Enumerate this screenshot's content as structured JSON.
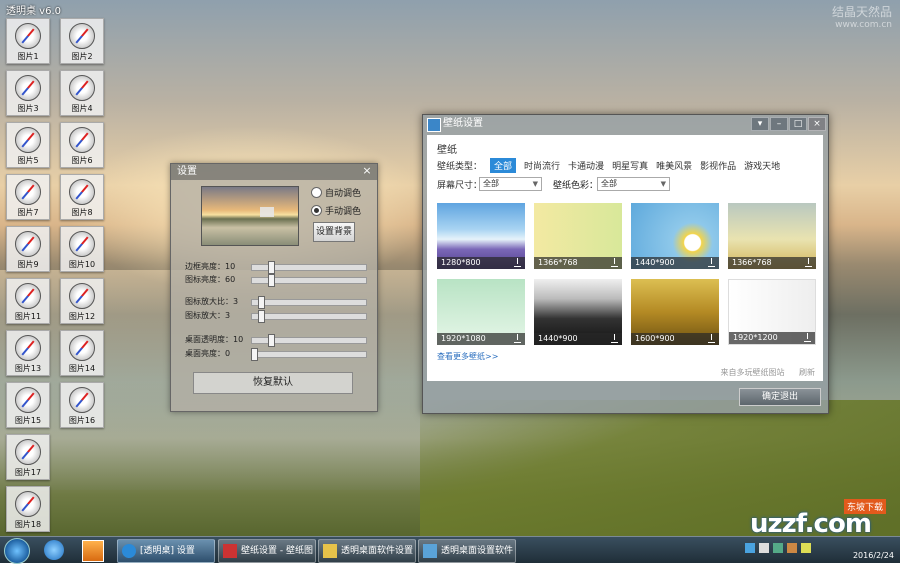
{
  "desktop": {
    "meta_text": "透明桌 v6.0",
    "watermark": {
      "line1": "结晶天然品",
      "line2": "www.com.cn"
    },
    "icons": [
      {
        "label": "图片1"
      },
      {
        "label": "图片2"
      },
      {
        "label": "图片3"
      },
      {
        "label": "图片4"
      },
      {
        "label": "图片5"
      },
      {
        "label": "图片6"
      },
      {
        "label": "图片7"
      },
      {
        "label": "图片8"
      },
      {
        "label": "图片9"
      },
      {
        "label": "图片10"
      },
      {
        "label": "图片11"
      },
      {
        "label": "图片12"
      },
      {
        "label": "图片13"
      },
      {
        "label": "图片14"
      },
      {
        "label": "图片15"
      },
      {
        "label": "图片16"
      },
      {
        "label": "图片17"
      },
      {
        "label": "图片18"
      }
    ]
  },
  "settings": {
    "title": "设置",
    "radio_1": "自动调色",
    "radio_2": "手动调色",
    "radio_selected": 2,
    "preview_button": "设置背景",
    "sliders": [
      {
        "label": "边框亮度：10",
        "value": 0.17
      },
      {
        "label": "图标亮度：60",
        "value": 0.17
      },
      {
        "label": "图标放大比：3",
        "value": 0.08
      },
      {
        "label": "图标放大：3",
        "value": 0.08
      },
      {
        "label": "桌面透明度：10",
        "value": 0.17
      },
      {
        "label": "桌面亮度：0",
        "value": 0.02
      }
    ],
    "apply_button": "恢复默认"
  },
  "wallpaper": {
    "window_title": "壁纸设置",
    "title": "壁纸",
    "category_label": "壁纸类型：",
    "categories": [
      "全部",
      "时尚流行",
      "卡通动漫",
      "明星写真",
      "唯美风景",
      "影视作品",
      "游戏天地"
    ],
    "selected_category": 0,
    "size_label": "屏幕尺寸：",
    "size_value": "全部",
    "color_label": "壁纸色彩：",
    "color_value": "全部",
    "thumbnails": [
      {
        "res": "1280*800"
      },
      {
        "res": "1366*768"
      },
      {
        "res": "1440*900"
      },
      {
        "res": "1366*768"
      },
      {
        "res": "1920*1080"
      },
      {
        "res": "1440*900"
      },
      {
        "res": "1600*900"
      },
      {
        "res": "1920*1200"
      }
    ],
    "more_link": "查看更多壁纸>>",
    "footer_left": "来自多玩壁纸图站",
    "footer_right": "刷新",
    "ok_button": "确定退出"
  },
  "taskbar": {
    "buttons": [
      {
        "label": "[透明桌] 设置",
        "active": true
      },
      {
        "label": "壁纸设置 - 壁纸图",
        "active": false
      },
      {
        "label": "透明桌面软件设置",
        "active": false
      },
      {
        "label": "透明桌面设置软件",
        "active": false
      }
    ],
    "clock": "2016/2/24"
  },
  "brand": {
    "name": "uzzf.com",
    "tag": "东坡下载"
  }
}
